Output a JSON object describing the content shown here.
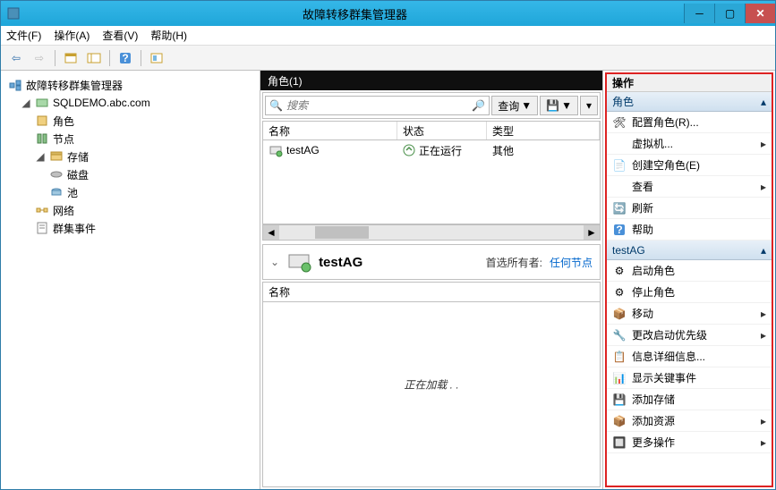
{
  "window": {
    "title": "故障转移群集管理器"
  },
  "menu": {
    "file": "文件(F)",
    "action": "操作(A)",
    "view": "查看(V)",
    "help": "帮助(H)"
  },
  "tree": {
    "root": "故障转移群集管理器",
    "cluster": "SQLDEMO.abc.com",
    "roles": "角色",
    "nodes": "节点",
    "storage": "存储",
    "disks": "磁盘",
    "pools": "池",
    "networks": "网络",
    "events": "群集事件"
  },
  "mid": {
    "header": "角色(1)",
    "search_placeholder": "搜索",
    "query_btn": "查询",
    "cols": {
      "name": "名称",
      "status": "状态",
      "type": "类型"
    },
    "rows": [
      {
        "name": "testAG",
        "status": "正在运行",
        "type": "其他"
      }
    ],
    "detail": {
      "name": "testAG",
      "pref_owner_label": "首选所有者:",
      "pref_owner_value": "任何节点",
      "col_name": "名称",
      "loading": "正在加载 . ."
    }
  },
  "actions": {
    "title": "操作",
    "group1": "角色",
    "g1": {
      "configure": "配置角色(R)...",
      "vm": "虚拟机...",
      "create_empty": "创建空角色(E)",
      "view": "查看",
      "refresh": "刷新",
      "help": "帮助"
    },
    "group2": "testAG",
    "g2": {
      "start": "启动角色",
      "stop": "停止角色",
      "move": "移动",
      "priority": "更改启动优先级",
      "info": "信息详细信息...",
      "critical": "显示关键事件",
      "add_storage": "添加存储",
      "add_resource": "添加资源",
      "more": "更多操作"
    }
  }
}
